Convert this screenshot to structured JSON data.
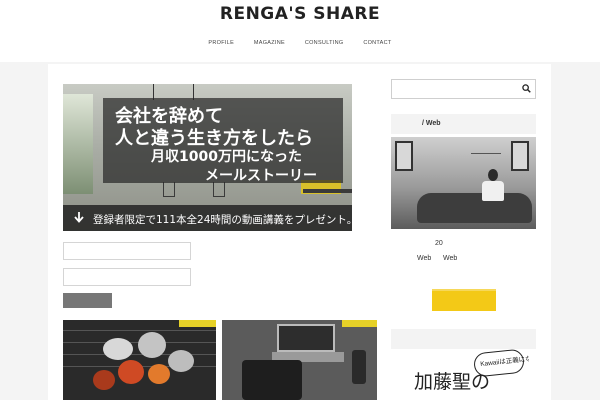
{
  "site": {
    "title": "RENGA'S SHARE"
  },
  "nav": {
    "items": [
      "PROFILE",
      "MAGAZINE",
      "CONSULTING",
      "CONTACT"
    ]
  },
  "banner": {
    "line1": "会社を辞めて",
    "line2": "人と違う生き方をしたら",
    "line3": "月収1000万円になった",
    "line4": "メールストーリー",
    "bottom": "登録者限定で111本全24時間の動画講義をプレゼント。"
  },
  "sidebar": {
    "profile_heading": "/ Web",
    "profile_number": "20",
    "profile_word_a": "Web",
    "profile_word_b": "Web",
    "book_text": "加藤聖の",
    "book_bubble": "Kawaiiは正義になる"
  },
  "colors": {
    "accent_yellow": "#f3c917",
    "tag_yellow": "#e6d128",
    "button_gray": "#777777"
  },
  "icons": {
    "search": "search-icon",
    "down_arrow": "arrow-down-icon"
  }
}
